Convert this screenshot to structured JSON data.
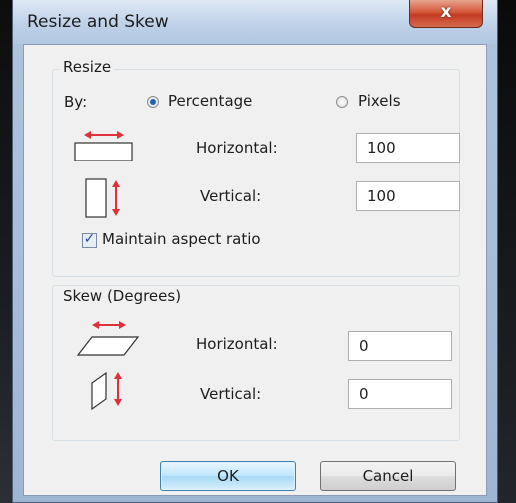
{
  "dialog": {
    "title": "Resize and Skew",
    "close_label": "x"
  },
  "resize": {
    "legend": "Resize",
    "by_label": "By:",
    "option_percentage": "Percentage",
    "option_pixels": "Pixels",
    "selected_option": "Percentage",
    "horizontal_label": "Horizontal:",
    "horizontal_value": "100",
    "vertical_label": "Vertical:",
    "vertical_value": "100",
    "maintain_label": "Maintain aspect ratio",
    "maintain_checked": true
  },
  "skew": {
    "legend": "Skew (Degrees)",
    "horizontal_label": "Horizontal:",
    "horizontal_value": "0",
    "vertical_label": "Vertical:",
    "vertical_value": "0"
  },
  "buttons": {
    "ok": "OK",
    "cancel": "Cancel"
  },
  "colors": {
    "arrow": "#e0303a",
    "accent": "#1e63b8"
  },
  "icons": {
    "resize_horizontal": "resize-horizontal-icon",
    "resize_vertical": "resize-vertical-icon",
    "skew_horizontal": "skew-horizontal-icon",
    "skew_vertical": "skew-vertical-icon"
  }
}
